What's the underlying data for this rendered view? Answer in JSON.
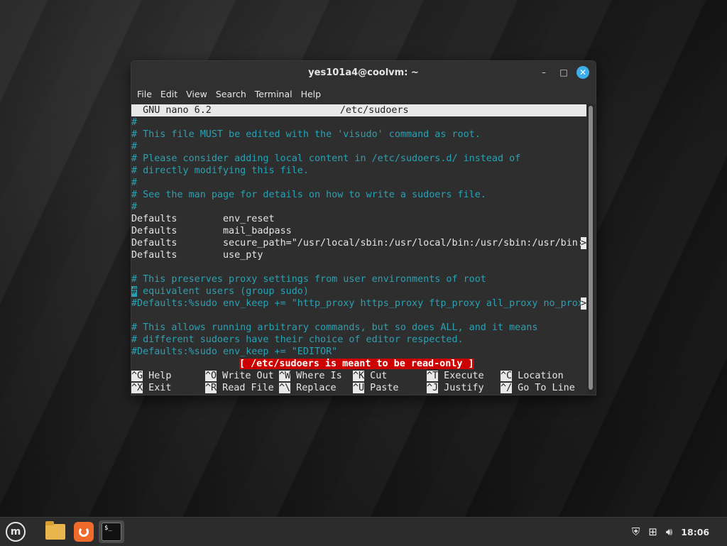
{
  "window": {
    "title": "yes101a4@coolvm: ~",
    "minimize": "–",
    "maximize": "□",
    "close": "✕"
  },
  "menubar": [
    "File",
    "Edit",
    "View",
    "Search",
    "Terminal",
    "Help"
  ],
  "nano": {
    "header_left": "  GNU nano 6.2",
    "header_center": "/etc/sudoers",
    "lines": [
      {
        "type": "comment",
        "text": "#"
      },
      {
        "type": "comment",
        "text": "# This file MUST be edited with the 'visudo' command as root."
      },
      {
        "type": "comment",
        "text": "#"
      },
      {
        "type": "comment",
        "text": "# Please consider adding local content in /etc/sudoers.d/ instead of"
      },
      {
        "type": "comment",
        "text": "# directly modifying this file."
      },
      {
        "type": "comment",
        "text": "#"
      },
      {
        "type": "comment",
        "text": "# See the man page for details on how to write a sudoers file."
      },
      {
        "type": "comment",
        "text": "#"
      },
      {
        "type": "normal",
        "text": "Defaults        env_reset"
      },
      {
        "type": "normal",
        "text": "Defaults        mail_badpass"
      },
      {
        "type": "normal",
        "text": "Defaults        secure_path=\"/usr/local/sbin:/usr/local/bin:/usr/sbin:/usr/bin:",
        "overflow": ">"
      },
      {
        "type": "normal",
        "text": "Defaults        use_pty"
      },
      {
        "type": "blank",
        "text": ""
      },
      {
        "type": "comment",
        "text": "# This preserves proxy settings from user environments of root"
      },
      {
        "type": "comment-cursor",
        "cursor": "#",
        "text": " equivalent users (group sudo)"
      },
      {
        "type": "comment",
        "text": "#Defaults:%sudo env_keep += \"http_proxy https_proxy ftp_proxy all_proxy no_prox",
        "overflow": ">"
      },
      {
        "type": "blank",
        "text": ""
      },
      {
        "type": "comment",
        "text": "# This allows running arbitrary commands, but so does ALL, and it means"
      },
      {
        "type": "comment",
        "text": "# different sudoers have their choice of editor respected."
      },
      {
        "type": "comment",
        "text": "#Defaults:%sudo env_keep += \"EDITOR\""
      }
    ],
    "status": "[ /etc/sudoers is meant to be read-only ]",
    "shortcuts_row1": [
      {
        "key": "^G",
        "label": " Help"
      },
      {
        "key": "^O",
        "label": " Write Out"
      },
      {
        "key": "^W",
        "label": " Where Is"
      },
      {
        "key": "^K",
        "label": " Cut"
      },
      {
        "key": "^T",
        "label": " Execute"
      },
      {
        "key": "^C",
        "label": " Location"
      }
    ],
    "shortcuts_row2": [
      {
        "key": "^X",
        "label": " Exit"
      },
      {
        "key": "^R",
        "label": " Read File"
      },
      {
        "key": "^\\",
        "label": " Replace"
      },
      {
        "key": "^U",
        "label": " Paste"
      },
      {
        "key": "^J",
        "label": " Justify"
      },
      {
        "key": "^/",
        "label": " Go To Line"
      }
    ]
  },
  "taskbar": {
    "clock": "18:06",
    "icons": [
      "mint-menu-icon",
      "files-icon",
      "updates-icon",
      "terminal-icon"
    ],
    "tray": [
      "shield-icon",
      "network-icon",
      "volume-icon"
    ],
    "terminal_glyph": "$_"
  }
}
